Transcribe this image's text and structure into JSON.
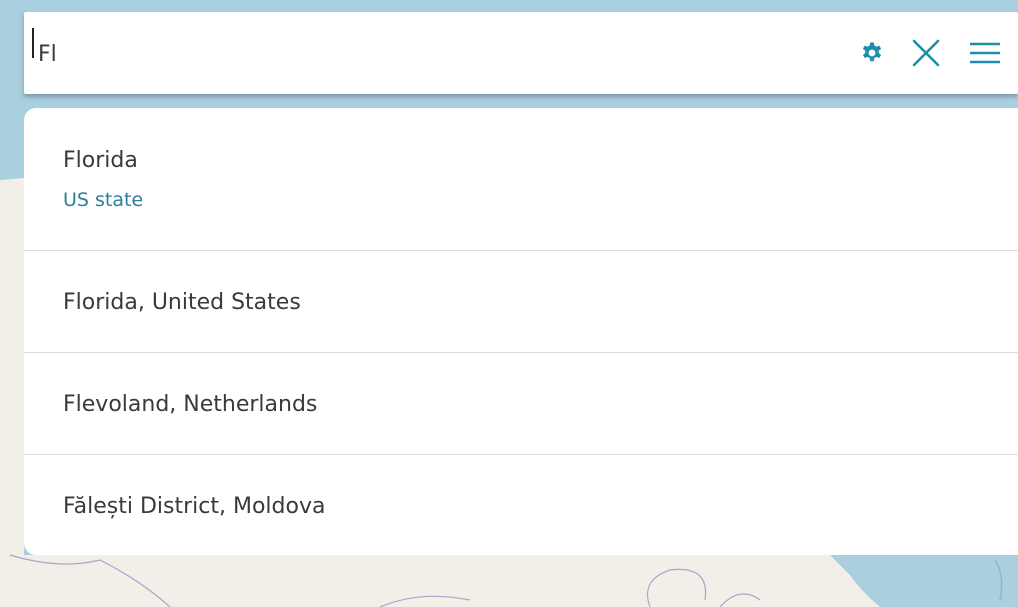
{
  "search": {
    "value": "Fl",
    "placeholder": ""
  },
  "toolbar": {
    "settings_icon": "gear-icon",
    "clear_icon": "close-icon",
    "menu_icon": "hamburger-menu-icon"
  },
  "results": [
    {
      "title": "Florida",
      "subtitle": "US state"
    },
    {
      "title": "Florida, United States"
    },
    {
      "title": "Flevoland, Netherlands"
    },
    {
      "title": "Fălești District, Moldova"
    }
  ],
  "colors": {
    "accent": "#1f8dab",
    "subtitle": "#2e7d99",
    "water": "#aacfdf",
    "land": "#f2efe9"
  }
}
